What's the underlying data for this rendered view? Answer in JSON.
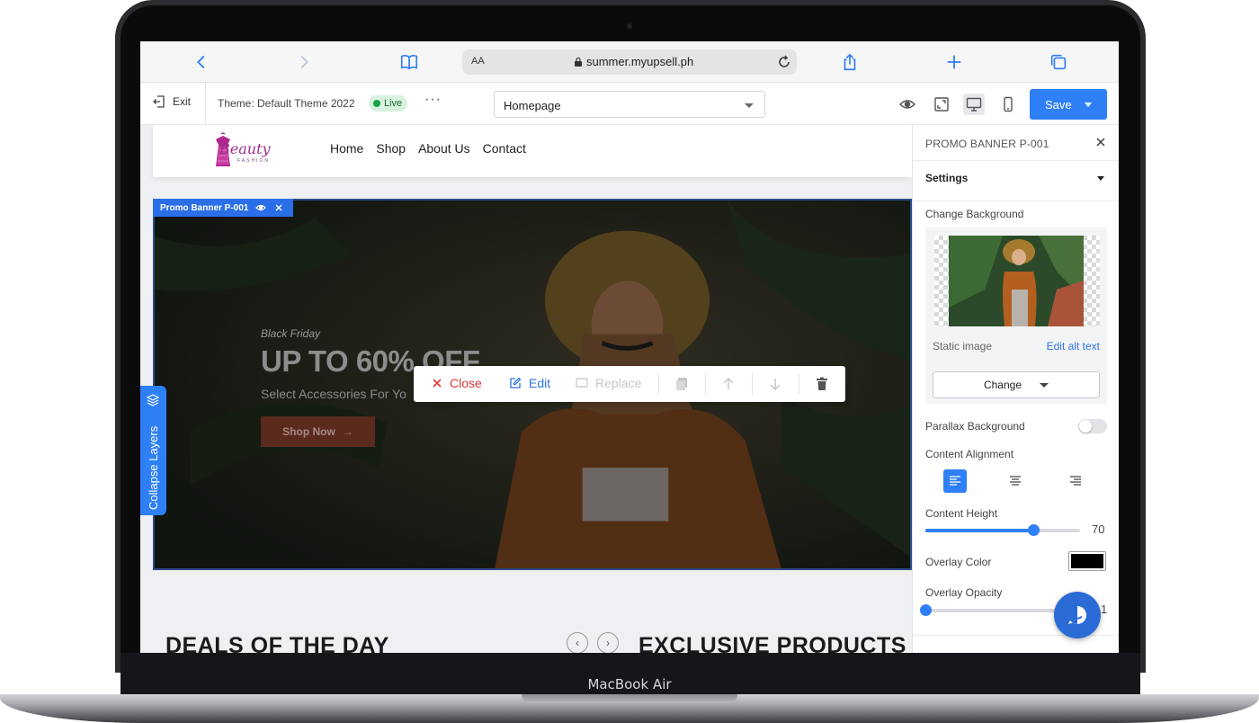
{
  "device": {
    "label": "MacBook Air"
  },
  "browser": {
    "text_size_label": "AA",
    "url": "summer.myupsell.ph"
  },
  "editor": {
    "exit_label": "Exit",
    "theme_label": "Theme: Default Theme 2022",
    "status_badge": "Live",
    "more_label": "···",
    "page_select": "Homepage",
    "save_label": "Save"
  },
  "site": {
    "logo_text": "Beauty",
    "logo_subtext": "FASHION",
    "nav": [
      "Home",
      "Shop",
      "About Us",
      "Contact"
    ],
    "banner": {
      "tag": "Promo Banner P-001",
      "eyebrow": "Black Friday",
      "headline": "UP TO 60% OFF",
      "subline": "Select Accessories For Yo",
      "cta": "Shop Now"
    },
    "deals_heading": "DEALS OF THE DAY",
    "exclusive_heading": "EXCLUSIVE PRODUCTS"
  },
  "block_toolbar": {
    "close_label": "Close",
    "edit_label": "Edit",
    "replace_label": "Replace"
  },
  "layers": {
    "label": "Collapse Layers"
  },
  "panel": {
    "title": "PROMO BANNER P-001",
    "section": "Settings",
    "change_bg_label": "Change Background",
    "image_type": "Static image",
    "alt_link": "Edit alt text",
    "change_button": "Change",
    "parallax_label": "Parallax Background",
    "parallax_on": false,
    "alignment_label": "Content Alignment",
    "alignment_selected": "left",
    "height_label": "Content Height",
    "height_value": "70",
    "height_fraction": 0.7,
    "overlay_color_label": "Overlay Color",
    "overlay_color": "#000000",
    "opacity_label": "Overlay Opacity",
    "opacity_value": "1",
    "opacity_fraction": 0.0
  },
  "colors": {
    "accent": "#2f80f7",
    "live_green": "#16a34a",
    "close_red": "#d93838",
    "banner_border": "#2b4a86"
  }
}
